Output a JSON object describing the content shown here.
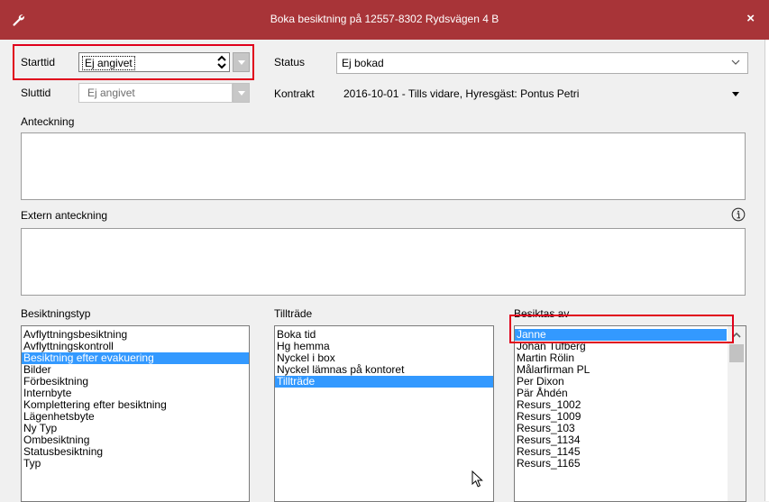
{
  "window": {
    "title": "Boka besiktning på 12557-8302 Rydsvägen 4 B",
    "close_glyph": "×"
  },
  "form": {
    "starttid": {
      "label": "Starttid",
      "value": "Ej angivet"
    },
    "sluttid": {
      "label": "Sluttid",
      "value": "Ej angivet"
    },
    "status": {
      "label": "Status",
      "value": "Ej bokad"
    },
    "kontrakt": {
      "label": "Kontrakt",
      "value": "2016-10-01 - Tills vidare, Hyresgäst: Pontus Petri"
    },
    "anteckning": {
      "label": "Anteckning"
    },
    "extern_anteckning": {
      "label": "Extern anteckning"
    }
  },
  "lists": {
    "besiktningstyp": {
      "label": "Besiktningstyp",
      "selected_index": 2,
      "items": [
        "Avflyttningsbesiktning",
        "Avflyttningskontroll",
        "Besiktning efter evakuering",
        "Bilder",
        "Förbesiktning",
        "Internbyte",
        "Komplettering efter besiktning",
        "Lägenhetsbyte",
        "Ny Typ",
        "Ombesiktning",
        "Statusbesiktning",
        "Typ"
      ]
    },
    "tilltrade": {
      "label": "Tillträde",
      "selected_index": 4,
      "items": [
        "Boka tid",
        "Hg hemma",
        "Nyckel i box",
        "Nyckel lämnas på kontoret",
        "Tillträde"
      ]
    },
    "besiktas_av": {
      "label": "Besiktas av",
      "selected_index": 0,
      "items": [
        "Janne",
        "Johan Tufberg",
        "Martin Rölin",
        "Målarfirman PL",
        "Per Dixon",
        "Pär Åhdén",
        "Resurs_1002",
        "Resurs_1009",
        "Resurs_103",
        "Resurs_1134",
        "Resurs_1145",
        "Resurs_1165"
      ]
    }
  },
  "colors": {
    "titlebar": "#a83438",
    "selection": "#3399ff",
    "highlight_box": "#e0001b"
  }
}
